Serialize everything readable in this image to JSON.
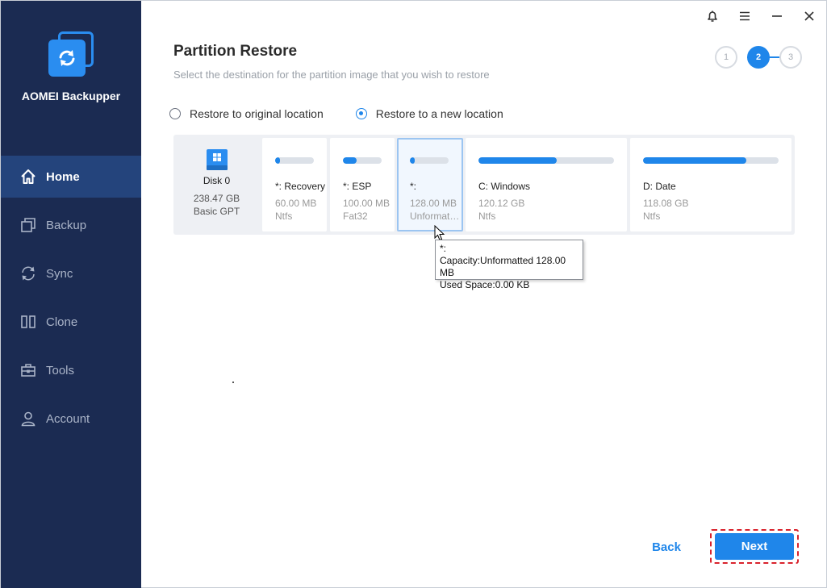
{
  "app": {
    "name": "AOMEI Backupper"
  },
  "sidebar": {
    "items": [
      {
        "label": "Home",
        "icon": "home-icon",
        "active": true
      },
      {
        "label": "Backup",
        "icon": "backup-icon"
      },
      {
        "label": "Sync",
        "icon": "sync-icon"
      },
      {
        "label": "Clone",
        "icon": "clone-icon"
      },
      {
        "label": "Tools",
        "icon": "tools-icon"
      },
      {
        "label": "Account",
        "icon": "account-icon"
      }
    ]
  },
  "window_controls": [
    "bell-icon",
    "menu-icon",
    "minimize-icon",
    "close-icon"
  ],
  "page": {
    "title": "Partition Restore",
    "subtitle": "Select the destination for the partition image that you wish to restore"
  },
  "stepper": {
    "steps": [
      "1",
      "2",
      "3"
    ],
    "current": 2
  },
  "restore_options": {
    "original": "Restore to original location",
    "new": "Restore to a new location",
    "selected": "new"
  },
  "disk": {
    "name": "Disk 0",
    "size": "238.47 GB",
    "type": "Basic GPT",
    "partitions": [
      {
        "name": "*: Recovery",
        "size": "60.00 MB",
        "fs": "Ntfs",
        "used_fraction": 0.1
      },
      {
        "name": "*: ESP",
        "size": "100.00 MB",
        "fs": "Fat32",
        "used_fraction": 0.35
      },
      {
        "name": "*:",
        "size": "128.00 MB",
        "fs": "Unformatted",
        "used_fraction": 0.05,
        "selected": true
      },
      {
        "name": "C: Windows",
        "size": "120.12 GB",
        "fs": "Ntfs",
        "used_fraction": 0.58
      },
      {
        "name": "D: Date",
        "size": "118.08 GB",
        "fs": "Ntfs",
        "used_fraction": 0.76
      }
    ]
  },
  "tooltip": {
    "line1": "*:",
    "line2": "Capacity:Unformatted 128.00 MB",
    "line3": "Used Space:0.00 KB"
  },
  "buttons": {
    "back": "Back",
    "next": "Next"
  },
  "colors": {
    "sidebar": "#1b2b52",
    "active_nav": "#24447c",
    "accent": "#1f86ea",
    "highlight": "#d9232d"
  }
}
